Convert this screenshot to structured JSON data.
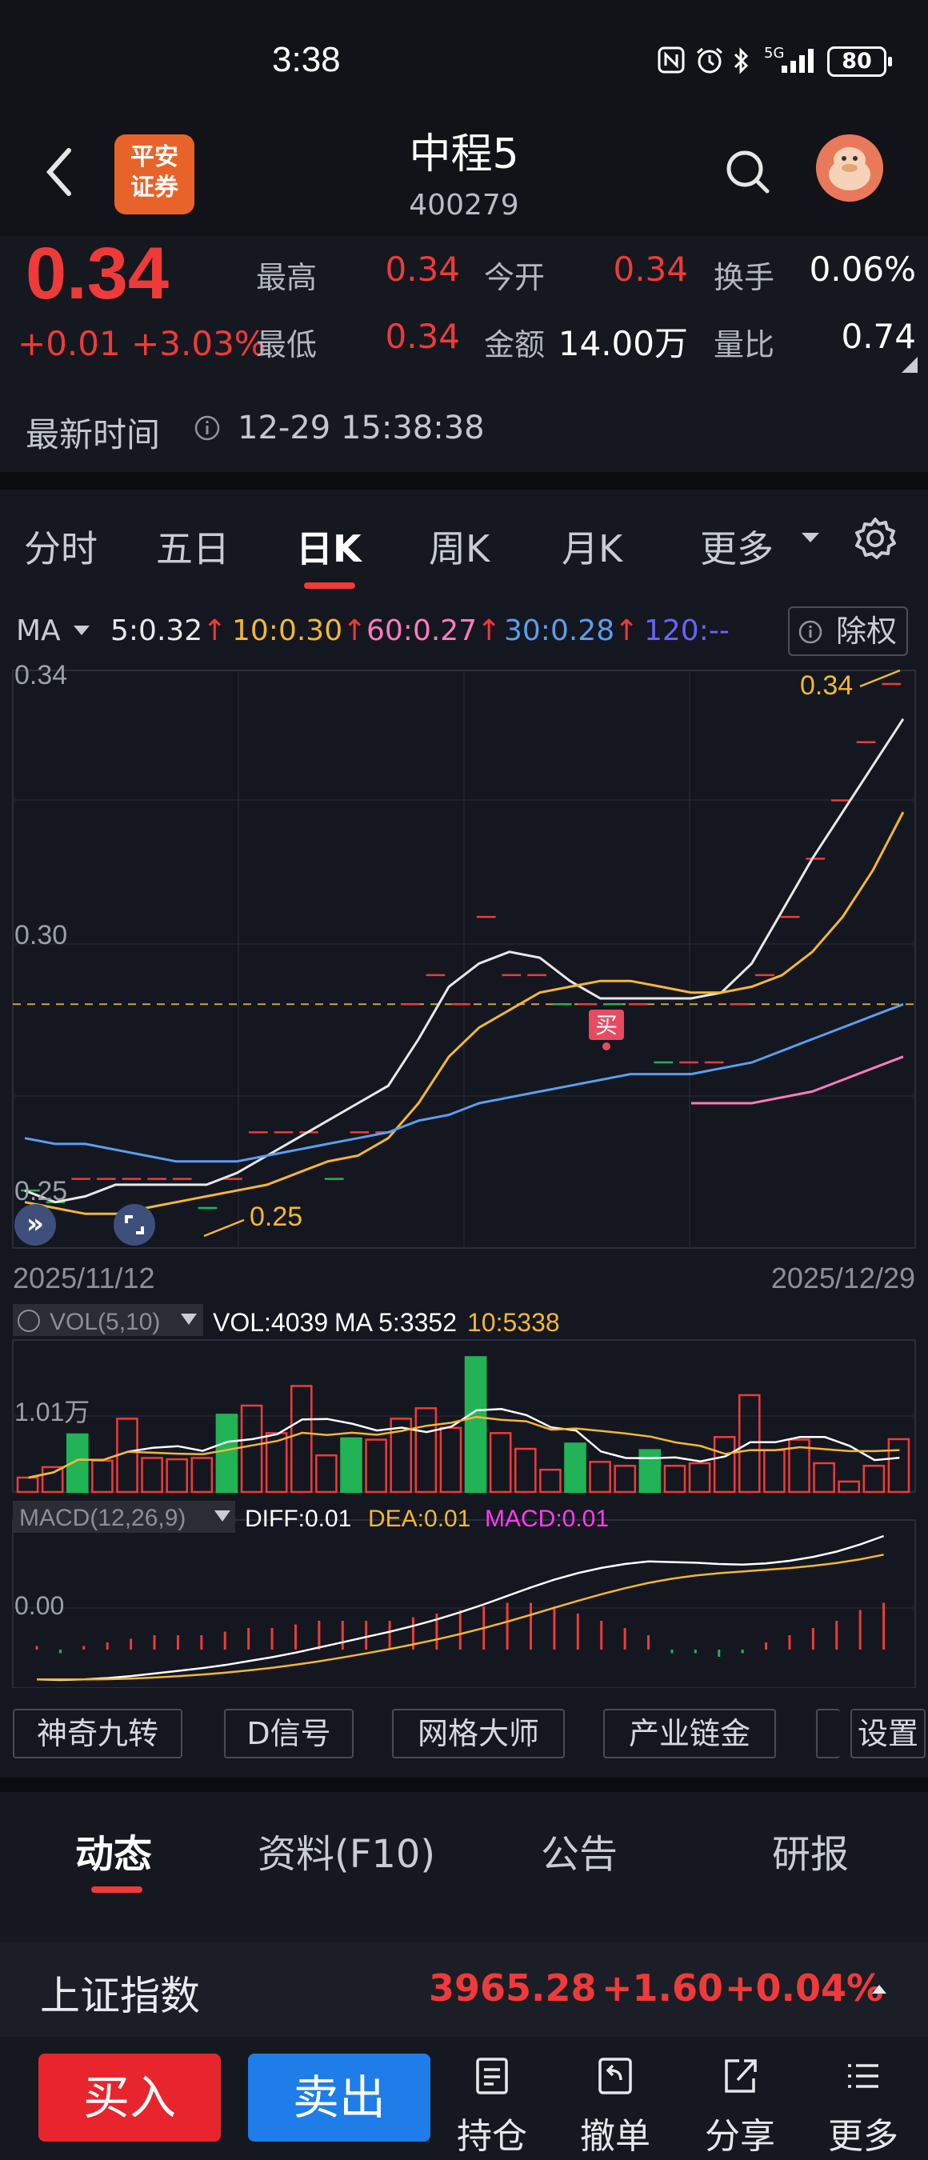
{
  "status_bar": {
    "time": "3:38",
    "network": "5G",
    "battery": "80"
  },
  "header": {
    "back_icon": "chevron-left-icon",
    "logo_text_1": "平安",
    "logo_text_2": "证券",
    "title": "中程5",
    "code": "400279"
  },
  "quote": {
    "price": "0.34",
    "change": "+0.01",
    "change_pct": "+3.03%",
    "high_label": "最高",
    "high": "0.34",
    "open_label": "今开",
    "open": "0.34",
    "turnover_label": "换手",
    "turnover": "0.06%",
    "low_label": "最低",
    "low": "0.34",
    "amount_label": "金额",
    "amount": "14.00万",
    "vol_ratio_label": "量比",
    "vol_ratio": "0.74",
    "update_label": "最新时间",
    "update_time": "12-29 15:38:38"
  },
  "tabs": [
    "分时",
    "五日",
    "日K",
    "周K",
    "月K",
    "更多"
  ],
  "active_tab": "日K",
  "ma_legend": {
    "label": "MA",
    "ma5": "5:0.32",
    "ma10": "10:0.30",
    "ma60": "60:0.27",
    "ma30": "30:0.28",
    "ma120": "120:--",
    "chuquan": "除权"
  },
  "colors": {
    "up": "#f03a3a",
    "down": "#21b356",
    "ma5": "#e8e8e8",
    "ma10": "#f5b731",
    "ma60": "#ff7bc0",
    "ma30": "#5b9ef0",
    "ma120": "#6a63ff",
    "buy": "#e8252c",
    "sell": "#1e7de8"
  },
  "chart_data": [
    {
      "type": "candlestick",
      "title": "日K",
      "y_ticks": [
        "0.34",
        "0.30",
        "0.25"
      ],
      "ylim": [
        0.25,
        0.34
      ],
      "x_start": "2025/11/12",
      "x_end": "2025/12/29",
      "max_marker": "0.34",
      "min_marker": "0.25",
      "buy_marker": "买",
      "reference_price": 0.285,
      "candles": [
        {
          "c": 0.253,
          "d": "down"
        },
        {
          "c": 0.251,
          "d": "down"
        },
        {
          "c": 0.255,
          "d": "up"
        },
        {
          "c": 0.255,
          "d": "up"
        },
        {
          "c": 0.255,
          "d": "up"
        },
        {
          "c": 0.255,
          "d": "up"
        },
        {
          "c": 0.255,
          "d": "up"
        },
        {
          "c": 0.25,
          "d": "down"
        },
        {
          "c": 0.255,
          "d": "up"
        },
        {
          "c": 0.263,
          "d": "up"
        },
        {
          "c": 0.263,
          "d": "up"
        },
        {
          "c": 0.263,
          "d": "up"
        },
        {
          "c": 0.255,
          "d": "down"
        },
        {
          "c": 0.263,
          "d": "up"
        },
        {
          "c": 0.263,
          "d": "up"
        },
        {
          "c": 0.285,
          "d": "up"
        },
        {
          "c": 0.29,
          "d": "up"
        },
        {
          "c": 0.285,
          "d": "up"
        },
        {
          "c": 0.3,
          "d": "up"
        },
        {
          "c": 0.29,
          "d": "up"
        },
        {
          "c": 0.29,
          "d": "up"
        },
        {
          "c": 0.285,
          "d": "down"
        },
        {
          "c": 0.285,
          "d": "up"
        },
        {
          "c": 0.285,
          "d": "down"
        },
        {
          "c": 0.285,
          "d": "up"
        },
        {
          "c": 0.275,
          "d": "down"
        },
        {
          "c": 0.275,
          "d": "up"
        },
        {
          "c": 0.275,
          "d": "up"
        },
        {
          "c": 0.285,
          "d": "up"
        },
        {
          "c": 0.29,
          "d": "up"
        },
        {
          "c": 0.3,
          "d": "up"
        },
        {
          "c": 0.31,
          "d": "up"
        },
        {
          "c": 0.32,
          "d": "up"
        },
        {
          "c": 0.33,
          "d": "up"
        },
        {
          "c": 0.34,
          "d": "up"
        }
      ],
      "series": [
        {
          "name": "MA5",
          "values": [
            0.253,
            0.251,
            0.252,
            0.254,
            0.254,
            0.254,
            0.254,
            0.256,
            0.259,
            0.262,
            0.265,
            0.268,
            0.271,
            0.279,
            0.288,
            0.292,
            0.294,
            0.293,
            0.289,
            0.286,
            0.286,
            0.286,
            0.286,
            0.287,
            0.292,
            0.301,
            0.31,
            0.318,
            0.326,
            0.334
          ]
        },
        {
          "name": "MA10",
          "values": [
            0.251,
            0.25,
            0.249,
            0.249,
            0.25,
            0.251,
            0.252,
            0.253,
            0.254,
            0.256,
            0.258,
            0.259,
            0.262,
            0.268,
            0.276,
            0.281,
            0.284,
            0.287,
            0.288,
            0.289,
            0.289,
            0.288,
            0.287,
            0.287,
            0.288,
            0.29,
            0.294,
            0.3,
            0.308,
            0.318
          ]
        },
        {
          "name": "MA30",
          "values": [
            0.262,
            0.261,
            0.261,
            0.26,
            0.259,
            0.258,
            0.258,
            0.258,
            0.259,
            0.26,
            0.261,
            0.262,
            0.263,
            0.265,
            0.266,
            0.268,
            0.269,
            0.27,
            0.271,
            0.272,
            0.273,
            0.273,
            0.273,
            0.274,
            0.275,
            0.277,
            0.279,
            0.281,
            0.283,
            0.285
          ]
        },
        {
          "name": "MA60",
          "values": [
            null,
            null,
            null,
            null,
            null,
            null,
            null,
            null,
            null,
            null,
            null,
            null,
            null,
            null,
            null,
            null,
            null,
            null,
            null,
            null,
            null,
            null,
            0.268,
            0.268,
            0.268,
            0.269,
            0.27,
            0.272,
            0.274,
            0.276
          ]
        }
      ]
    },
    {
      "type": "bar",
      "title": "VOL",
      "indicator_label": "VOL(5,10)",
      "vol_text": "VOL:4039",
      "ma5_text": "MA 5:3352",
      "ma10_text": "10:5338",
      "y_tick": "1.01万",
      "values": [
        1100,
        1900,
        4400,
        2400,
        5600,
        2600,
        2500,
        2600,
        5900,
        6600,
        4500,
        8100,
        2800,
        4100,
        4000,
        5600,
        6400,
        4900,
        10300,
        4500,
        3300,
        1700,
        3700,
        2300,
        2000,
        3200,
        2000,
        2200,
        4200,
        7400,
        3200,
        4000,
        2200,
        800,
        2000,
        4039
      ],
      "directions": [
        "up",
        "up",
        "down",
        "up",
        "up",
        "up",
        "up",
        "up",
        "down",
        "up",
        "up",
        "up",
        "up",
        "down",
        "up",
        "up",
        "up",
        "up",
        "down",
        "up",
        "up",
        "up",
        "down",
        "up",
        "up",
        "down",
        "up",
        "up",
        "up",
        "up",
        "up",
        "up",
        "up",
        "up",
        "up",
        "up"
      ]
    },
    {
      "type": "bar",
      "title": "MACD",
      "indicator_label": "MACD(12,26,9)",
      "diff_text": "DIFF:0.01",
      "dea_text": "DEA:0.01",
      "macd_text": "MACD:0.01",
      "y_tick": "0.00",
      "values": [
        0.0005,
        -0.0005,
        0.0005,
        0.001,
        0.0015,
        0.002,
        0.002,
        0.002,
        0.0025,
        0.003,
        0.003,
        0.0035,
        0.004,
        0.004,
        0.004,
        0.004,
        0.0045,
        0.005,
        0.0055,
        0.006,
        0.0065,
        0.0065,
        0.006,
        0.005,
        0.004,
        0.003,
        0.002,
        -0.0005,
        -0.0005,
        -0.001,
        -0.0005,
        0.001,
        0.002,
        0.003,
        0.004,
        0.0055,
        0.0065
      ]
    }
  ],
  "tools": [
    "神奇九转",
    "D信号",
    "网格大师",
    "产业链金"
  ],
  "tools_settings": "设置",
  "bottom_tabs": [
    "动态",
    "资料(F10)",
    "公告",
    "研报"
  ],
  "index": {
    "name": "上证指数",
    "value": "3965.28",
    "change": "+1.60",
    "change_pct": "+0.04%"
  },
  "actions": {
    "buy": "买入",
    "sell": "卖出",
    "items": [
      {
        "label": "持仓",
        "icon": "document-icon"
      },
      {
        "label": "撤单",
        "icon": "undo-icon"
      },
      {
        "label": "分享",
        "icon": "share-icon"
      },
      {
        "label": "更多",
        "icon": "menu-icon"
      }
    ]
  }
}
